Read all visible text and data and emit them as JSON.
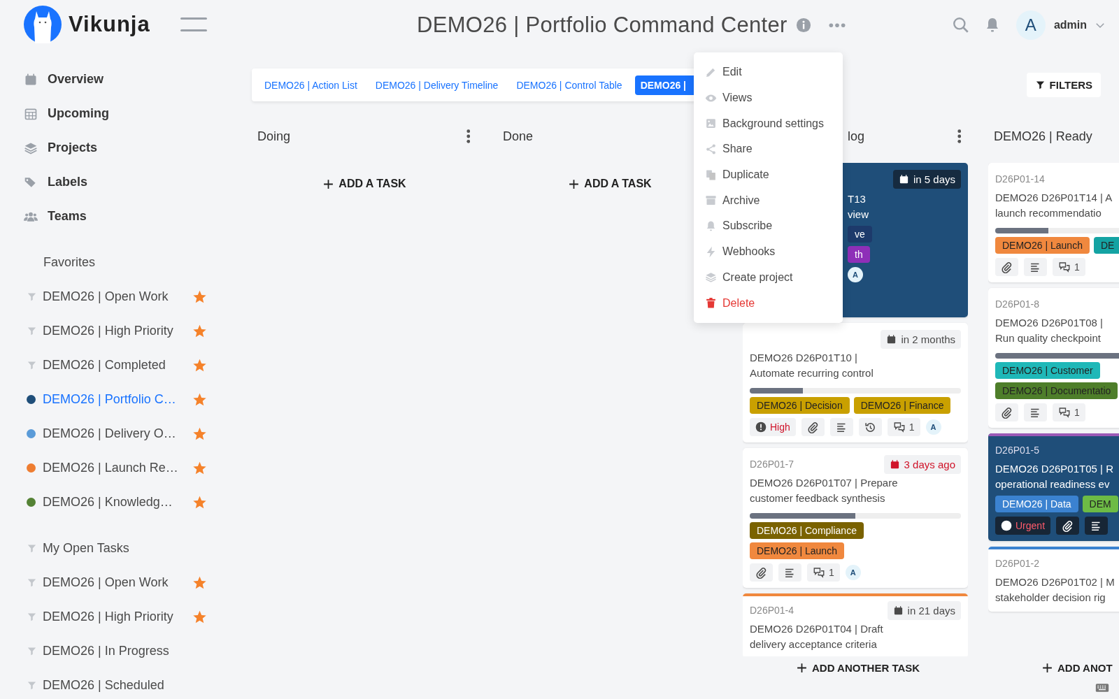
{
  "app": {
    "name": "Vikunja"
  },
  "nav": [
    "Overview",
    "Upcoming",
    "Projects",
    "Labels",
    "Teams"
  ],
  "sections": [
    {
      "title": "Favorites",
      "kind": "plain",
      "items": [
        {
          "label": "DEMO26 | Open Work",
          "kind": "filter",
          "favorite": true,
          "selected": false
        },
        {
          "label": "DEMO26 | High Priority",
          "kind": "filter",
          "favorite": true,
          "selected": false
        },
        {
          "label": "DEMO26 | Completed",
          "kind": "filter",
          "favorite": true,
          "selected": false
        },
        {
          "label": "DEMO26 | Portfolio C…",
          "kind": "project",
          "color": "#1f4e79",
          "favorite": true,
          "selected": true
        },
        {
          "label": "DEMO26 | Delivery O…",
          "kind": "project",
          "color": "#5a9bd8",
          "favorite": true,
          "selected": false
        },
        {
          "label": "DEMO26 | Launch Re…",
          "kind": "project",
          "color": "#ee7d31",
          "favorite": true,
          "selected": false
        },
        {
          "label": "DEMO26 | Knowledg…",
          "kind": "project",
          "color": "#548235",
          "favorite": true,
          "selected": false
        }
      ]
    },
    {
      "title": "My Open Tasks",
      "kind": "filter",
      "items": [
        {
          "label": "DEMO26 | Open Work",
          "kind": "filter",
          "favorite": true,
          "selected": false
        },
        {
          "label": "DEMO26 | High Priority",
          "kind": "filter",
          "favorite": true,
          "selected": false
        },
        {
          "label": "DEMO26 | In Progress",
          "kind": "filter",
          "favorite": false,
          "selected": false
        },
        {
          "label": "DEMO26 | Scheduled",
          "kind": "filter",
          "favorite": false,
          "selected": false
        }
      ]
    }
  ],
  "header": {
    "title": "DEMO26 | Portfolio Command Center",
    "user": {
      "initial": "A",
      "name": "admin"
    }
  },
  "tabs": [
    {
      "label": "DEMO26 | Action List",
      "selected": false
    },
    {
      "label": "DEMO26 | Delivery Timeline",
      "selected": false
    },
    {
      "label": "DEMO26 | Control Table",
      "selected": false
    },
    {
      "label": "DEMO26 |",
      "selected": true
    }
  ],
  "filters_button": "FILTERS",
  "menu": [
    {
      "label": "Edit",
      "kind": "normal"
    },
    {
      "label": "Views",
      "kind": "normal"
    },
    {
      "label": "Background settings",
      "kind": "normal"
    },
    {
      "label": "Share",
      "kind": "normal"
    },
    {
      "label": "Duplicate",
      "kind": "normal"
    },
    {
      "label": "Archive",
      "kind": "normal"
    },
    {
      "label": "Subscribe",
      "kind": "normal"
    },
    {
      "label": "Webhooks",
      "kind": "normal"
    },
    {
      "label": "Create project",
      "kind": "normal"
    },
    {
      "label": "Delete",
      "kind": "danger"
    }
  ],
  "columns": [
    {
      "title": "Doing",
      "menu": true,
      "occluded": false,
      "add": {
        "label": "ADD A TASK",
        "kind": "top"
      }
    },
    {
      "title": "Done",
      "occluded": false,
      "add": {
        "label": "ADD A TASK",
        "kind": "top"
      }
    },
    {
      "title": "log",
      "menu": true,
      "occluded": true,
      "add": {
        "label": "ADD ANOTHER TASK",
        "kind": "bottom"
      },
      "cards": [
        {
          "dark": true,
          "occluded": true,
          "due": {
            "text": "in 5 days",
            "overdue": false
          },
          "title": "T13\nview",
          "labels": [
            {
              "text": "ve",
              "color": "#1d3a6b",
              "dark_text": false
            },
            {
              "text": "th",
              "color": "#8e2fb8",
              "dark_text": false
            }
          ],
          "badges": [
            {
              "kind": "assignee",
              "text": "A"
            }
          ]
        },
        {
          "dark": false,
          "occluded": false,
          "due": {
            "text": "in 2 months",
            "overdue": false
          },
          "title": "DEMO26 D26P01T10 |\nAutomate recurring control",
          "level": 0.25,
          "labels": [
            {
              "text": "DEMO26 | Decision",
              "color": "#c9a000",
              "dark_text": true
            },
            {
              "text": "DEMO26 | Finance",
              "color": "#c9a000",
              "dark_text": true
            }
          ],
          "priority": {
            "text": "High"
          },
          "badges": [
            {
              "kind": "attachment"
            },
            {
              "kind": "description"
            },
            {
              "kind": "repeat"
            },
            {
              "kind": "comments",
              "text": "1"
            },
            {
              "kind": "assignee",
              "text": "A"
            }
          ]
        },
        {
          "dark": false,
          "occluded": false,
          "id": "D26P01-7",
          "due": {
            "text": "3 days ago",
            "overdue": true
          },
          "title": "DEMO26 D26P01T07 | Prepare\ncustomer feedback synthesis",
          "level": 0.5,
          "labels": [
            {
              "text": "DEMO26 | Compliance",
              "color": "#7a6200",
              "dark_text": false
            },
            {
              "text": "DEMO26 | Launch",
              "color": "#f0883e",
              "dark_text": true
            }
          ],
          "badges": [
            {
              "kind": "attachment"
            },
            {
              "kind": "description"
            },
            {
              "kind": "comments",
              "text": "1"
            },
            {
              "kind": "assignee",
              "text": "A"
            }
          ]
        },
        {
          "dark": false,
          "occluded": false,
          "color": "#f0883e",
          "id": "D26P01-4",
          "due": {
            "text": "in 21 days",
            "overdue": false
          },
          "title": "DEMO26 D26P01T04 | Draft\ndelivery acceptance criteria"
        }
      ]
    },
    {
      "title": "DEMO26 | Ready",
      "occluded": false,
      "add": {
        "label": "ADD ANOT",
        "kind": "bottom"
      },
      "cards": [
        {
          "dark": false,
          "occluded": false,
          "id": "D26P01-14",
          "title": "DEMO26 D26P01T14 | A\nlaunch recommendatio",
          "level": 0.25,
          "labels": [
            {
              "text": "DEMO26 | Launch",
              "color": "#f0883e",
              "dark_text": true
            },
            {
              "text": "DE",
              "color": "#14a3a3",
              "dark_text": true
            }
          ],
          "badges": [
            {
              "kind": "attachment"
            },
            {
              "kind": "description"
            },
            {
              "kind": "comments",
              "text": "1"
            }
          ]
        },
        {
          "dark": false,
          "occluded": false,
          "id": "D26P01-8",
          "title": "DEMO26 D26P01T08 |\nRun quality checkpoint",
          "level": 0.7,
          "labels": [
            {
              "text": "DEMO26 | Customer",
              "color": "#1fb8b8",
              "dark_text": true
            },
            {
              "text": "DEMO26 | Documentatio",
              "color": "#4e7e2a",
              "dark_text": true
            }
          ],
          "badges": [
            {
              "kind": "attachment"
            },
            {
              "kind": "description"
            },
            {
              "kind": "comments",
              "text": "1"
            }
          ]
        },
        {
          "dark": true,
          "occluded": false,
          "color": "#9b59b6",
          "id": "D26P01-5",
          "title": "DEMO26 D26P01T05 | R\noperational readiness ev",
          "labels": [
            {
              "text": "DEMO26 | Data",
              "color": "#3b82d0",
              "dark_text": false
            },
            {
              "text": "DEM",
              "color": "#6dbb45",
              "dark_text": true
            }
          ],
          "priority": {
            "text": "Urgent"
          },
          "badges": [
            {
              "kind": "attachment"
            },
            {
              "kind": "description"
            }
          ]
        },
        {
          "dark": false,
          "occluded": false,
          "color": "#3b82d0",
          "id": "D26P01-2",
          "title": "DEMO26 D26P01T02 | M\nstakeholder decision rig"
        }
      ]
    }
  ]
}
